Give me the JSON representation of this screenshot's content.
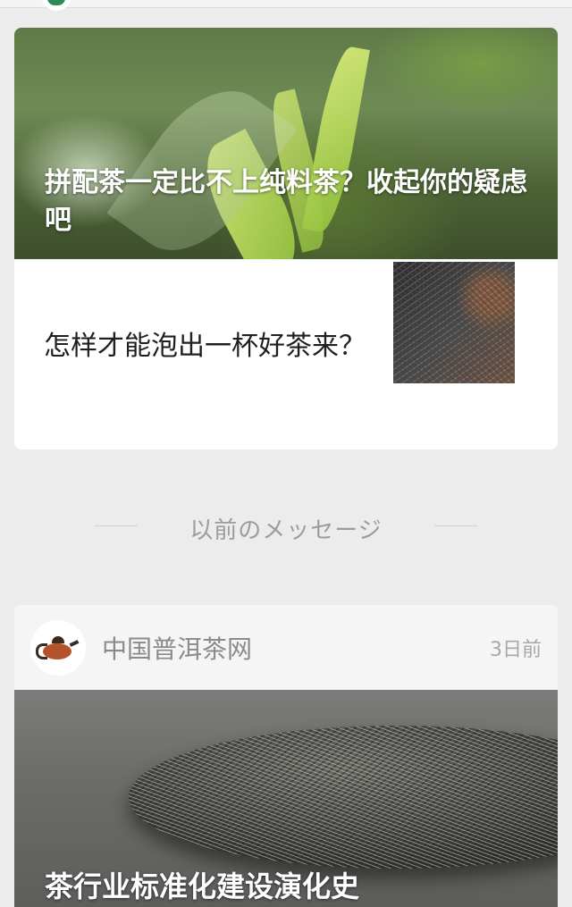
{
  "feed": {
    "top_article": {
      "title": "拼配茶一定比不上纯料茶？收起你的疑虑吧"
    },
    "second_article": {
      "title": "怎样才能泡出一杯好茶来？"
    },
    "separator_text": "以前のメッセージ",
    "account_card": {
      "source_name": "中国普洱茶网",
      "timestamp": "3日前",
      "article_title": "茶行业标准化建设演化史"
    }
  },
  "colors": {
    "background": "#ececec",
    "card": "#ffffff",
    "header_bg": "#f5f5f5",
    "muted_text": "#9c9c9c"
  },
  "icons": [
    "tea-account-logo-icon",
    "teapot-logo-icon"
  ]
}
